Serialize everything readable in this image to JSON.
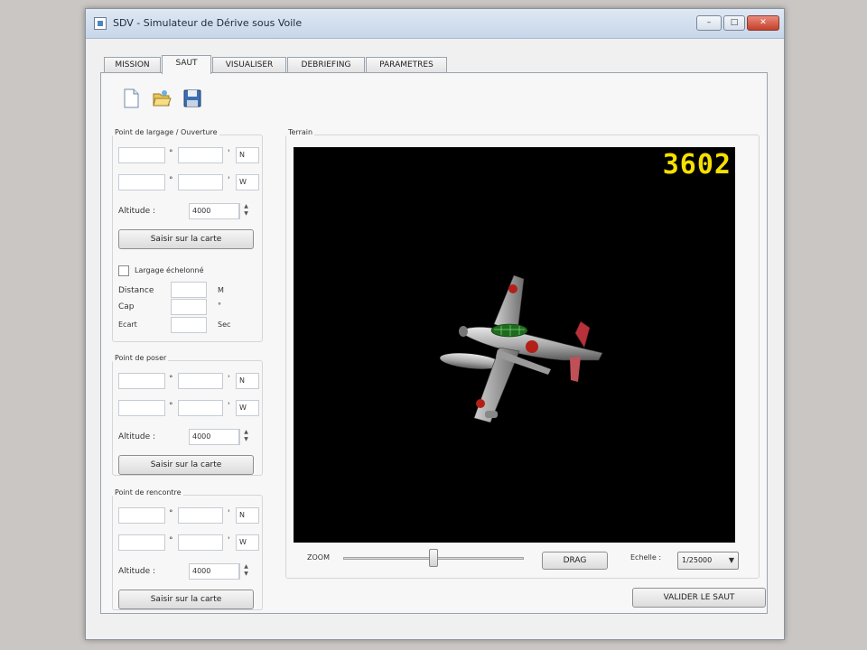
{
  "window": {
    "title": "SDV - Simulateur de Dérive sous Voile"
  },
  "tabs": [
    "MISSION",
    "SAUT",
    "VISUALISER",
    "DEBRIEFING",
    "PARAMETRES"
  ],
  "active_tab": "SAUT",
  "toolbar": {
    "icons": [
      "new-file-icon",
      "open-folder-icon",
      "save-disk-icon"
    ]
  },
  "largage": {
    "title": "Point de largage / Ouverture",
    "north": "N",
    "west": "W",
    "deg": "°",
    "altitude_label": "Altitude :",
    "altitude_value": "4000",
    "map_button": "Saisir sur la carte",
    "echelonne_label": "Largage échelonné",
    "distance_label": "Distance",
    "distance_unit": "M",
    "cap_label": "Cap",
    "cap_unit": "°",
    "ecart_label": "Ecart",
    "ecart_unit": "Sec"
  },
  "poser": {
    "title": "Point de poser",
    "north": "N",
    "west": "W",
    "deg": "°",
    "altitude_label": "Altitude :",
    "altitude_value": "4000",
    "map_button": "Saisir sur la carte"
  },
  "rencontre": {
    "title": "Point de rencontre",
    "north": "N",
    "west": "W",
    "deg": "°",
    "altitude_label": "Altitude :",
    "altitude_value": "4000",
    "map_button": "Saisir sur la carte"
  },
  "terrain": {
    "title": "Terrain",
    "counter": "3602",
    "zoom_label": "ZOOM",
    "zoom_level": 0.5,
    "drag_button": "DRAG",
    "scale_label": "Echelle :",
    "scale_value": "1/25000",
    "validate_button": "VALIDER LE SAUT"
  },
  "colors": {
    "counter": "#f5e000",
    "viewport_bg": "#000000"
  }
}
